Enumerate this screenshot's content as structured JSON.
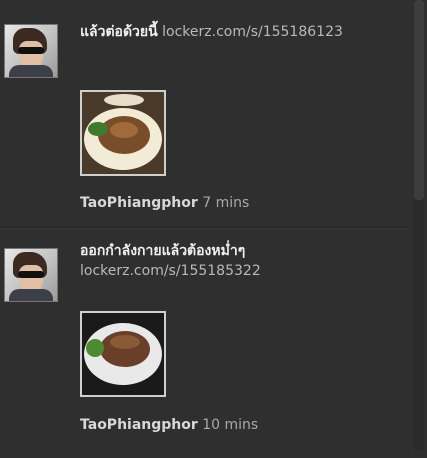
{
  "posts": [
    {
      "text_main": "แล้วต่อด้วยนี้",
      "text_link": "lockerz.com/s/155186123",
      "user": "TaoPhiangphor",
      "time": "7 mins",
      "thumbnail_icon": "food-photo-icon"
    },
    {
      "text_main": "ออกกำลังกายแล้วต้องหม่ำๆ",
      "text_link": "lockerz.com/s/155185322",
      "user": "TaoPhiangphor",
      "time": "10 mins",
      "thumbnail_icon": "food-photo-icon"
    }
  ],
  "colors": {
    "background": "#2f2f2f",
    "text": "#dcdcdc",
    "link": "#b9b9b9"
  }
}
